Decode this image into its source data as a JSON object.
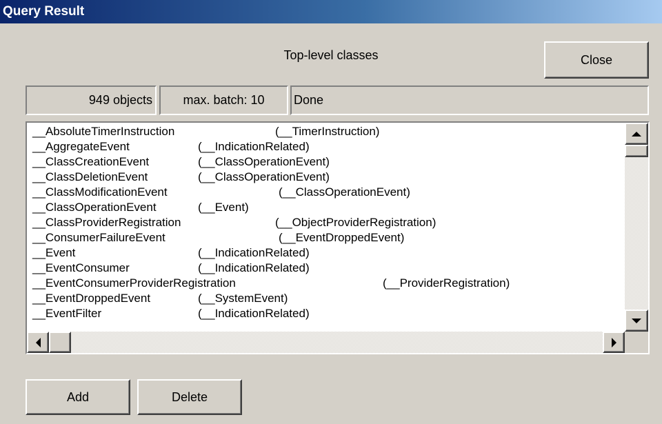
{
  "window": {
    "title": "Query Result"
  },
  "dialog": {
    "heading": "Top-level classes",
    "close_label": "Close"
  },
  "status": {
    "count": "949 objects",
    "batch": "max. batch: 10",
    "state": "Done"
  },
  "list": {
    "items": [
      {
        "name": "__AbsoluteTimerInstruction",
        "parent": "(__TimerInstruction)"
      },
      {
        "name": "__AggregateEvent",
        "parent": "(__IndicationRelated)"
      },
      {
        "name": "__ClassCreationEvent",
        "parent": "(__ClassOperationEvent)"
      },
      {
        "name": "__ClassDeletionEvent",
        "parent": "(__ClassOperationEvent)"
      },
      {
        "name": "__ClassModificationEvent",
        "parent": "(__ClassOperationEvent)"
      },
      {
        "name": "__ClassOperationEvent",
        "parent": "(__Event)"
      },
      {
        "name": "__ClassProviderRegistration",
        "parent": "(__ObjectProviderRegistration)"
      },
      {
        "name": "__ConsumerFailureEvent",
        "parent": "(__EventDroppedEvent)"
      },
      {
        "name": "__Event",
        "parent": "(__IndicationRelated)"
      },
      {
        "name": "__EventConsumer",
        "parent": "(__IndicationRelated)"
      },
      {
        "name": "__EventConsumerProviderRegistration",
        "parent": "(__ProviderRegistration)"
      },
      {
        "name": "__EventDroppedEvent",
        "parent": "(__SystemEvent)"
      },
      {
        "name": "__EventFilter",
        "parent": "(__IndicationRelated)"
      }
    ]
  },
  "actions": {
    "add_label": "Add",
    "delete_label": "Delete"
  },
  "colors": {
    "title_start": "#0a246a",
    "title_end": "#a6caf0",
    "face": "#d4d0c8"
  },
  "icons": {
    "scroll_up": "arrow-up-icon",
    "scroll_down": "arrow-down-icon",
    "scroll_left": "arrow-left-icon",
    "scroll_right": "arrow-right-icon"
  }
}
